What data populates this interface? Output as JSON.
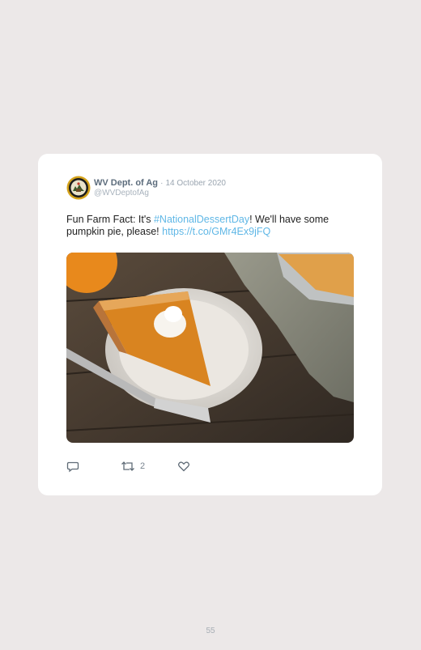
{
  "tweet": {
    "author_name": "WV Dept. of Ag",
    "separator": "·",
    "date": "14 October 2020",
    "handle": "@WVDeptofAg",
    "text_before": "Fun Farm Fact: It's ",
    "hashtag": "#NationalDessertDay",
    "text_middle": "! We'll have some pumpkin pie, please! ",
    "url": "https://t.co/GMr4Ex9jFQ",
    "image_subject": "Slice of pumpkin pie with whipped cream and fork",
    "icons": {
      "avatar": "wv-department-of-agriculture-seal",
      "reply": "reply-icon",
      "retweet": "retweet-icon",
      "like": "heart-icon"
    },
    "retweet_count": "2"
  },
  "page": {
    "number": "55"
  },
  "colors": {
    "background": "#ece8e8",
    "card": "#ffffff",
    "link": "#5fb7e6",
    "author": "#5c6c7c"
  }
}
